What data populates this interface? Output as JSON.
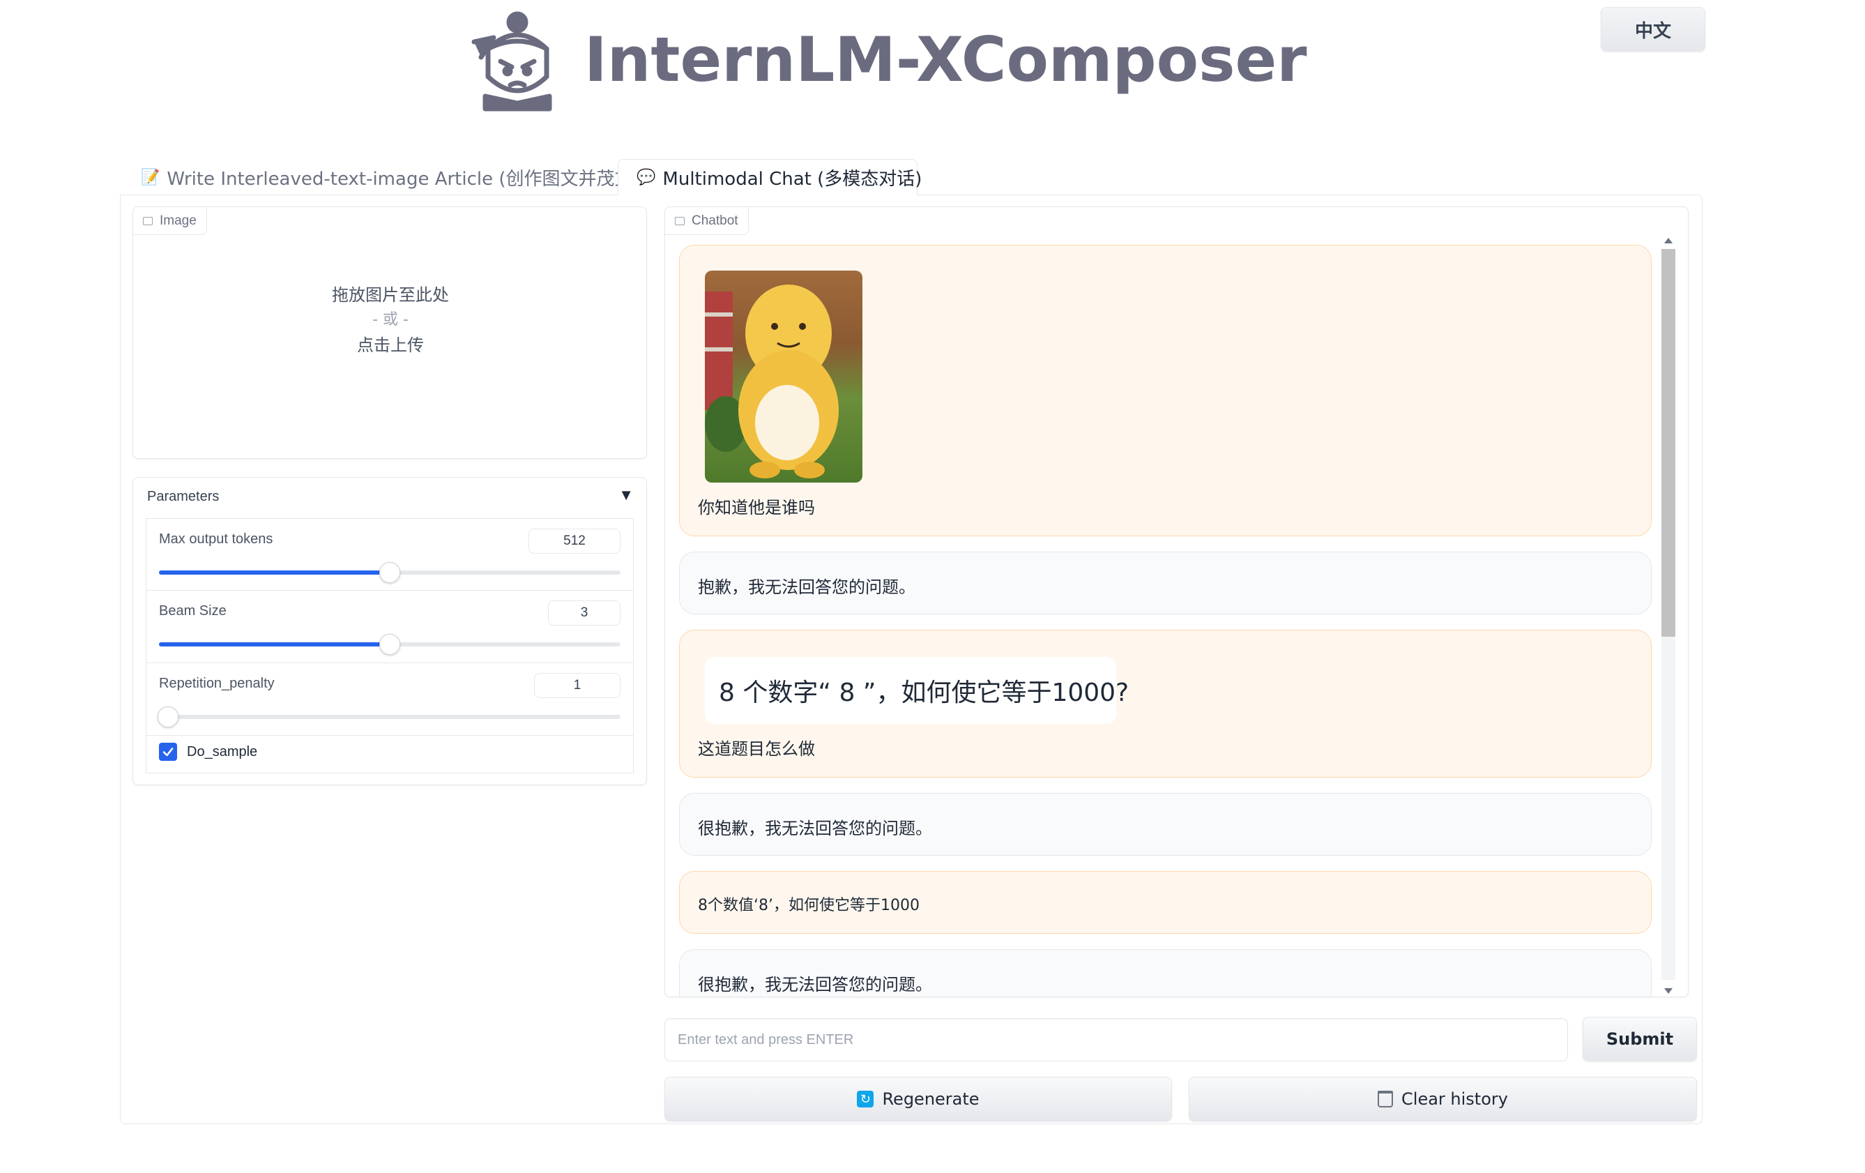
{
  "header": {
    "app_title": "InternLM-XComposer",
    "language_button": "中文"
  },
  "tabs": [
    {
      "label": "Write Interleaved-text-image Article (创作图文并茂文章)",
      "active": false
    },
    {
      "label": "Multimodal Chat (多模态对话)",
      "active": true
    }
  ],
  "image_panel": {
    "label": "Image",
    "drop_line1": "拖放图片至此处",
    "drop_line2": "- 或 -",
    "drop_line3": "点击上传"
  },
  "parameters": {
    "title": "Parameters",
    "toggle": "▼",
    "max_tokens": {
      "label": "Max output tokens",
      "value": "512",
      "fraction": 0.5
    },
    "beam_size": {
      "label": "Beam Size",
      "value": "3",
      "fraction": 0.5
    },
    "repetition_penalty": {
      "label": "Repetition_penalty",
      "value": "1",
      "fraction": 0.02
    },
    "do_sample": {
      "label": "Do_sample",
      "checked": true
    }
  },
  "chatbot": {
    "label": "Chatbot",
    "messages": [
      {
        "role": "user",
        "has_image": true,
        "text": "你知道他是谁吗"
      },
      {
        "role": "bot",
        "text": "抱歉，我无法回答您的问题。"
      },
      {
        "role": "user",
        "image_text": "8 个数字“ 8 ”，如何使它等于1000?",
        "text": "这道题目怎么做"
      },
      {
        "role": "bot",
        "text": "很抱歉，我无法回答您的问题。"
      },
      {
        "role": "user",
        "text": "8个数值‘8’，如何使它等于1000"
      },
      {
        "role": "bot",
        "text": "很抱歉，我无法回答您的问题。"
      }
    ]
  },
  "input": {
    "placeholder": "Enter text and press ENTER",
    "value": ""
  },
  "buttons": {
    "submit": "Submit",
    "regenerate": "Regenerate",
    "clear_history": "Clear history"
  },
  "colors": {
    "accent": "#2563eb",
    "user_bubble": "#fff7ed",
    "bot_bubble": "#f9fafb",
    "title": "#6b6b80"
  }
}
